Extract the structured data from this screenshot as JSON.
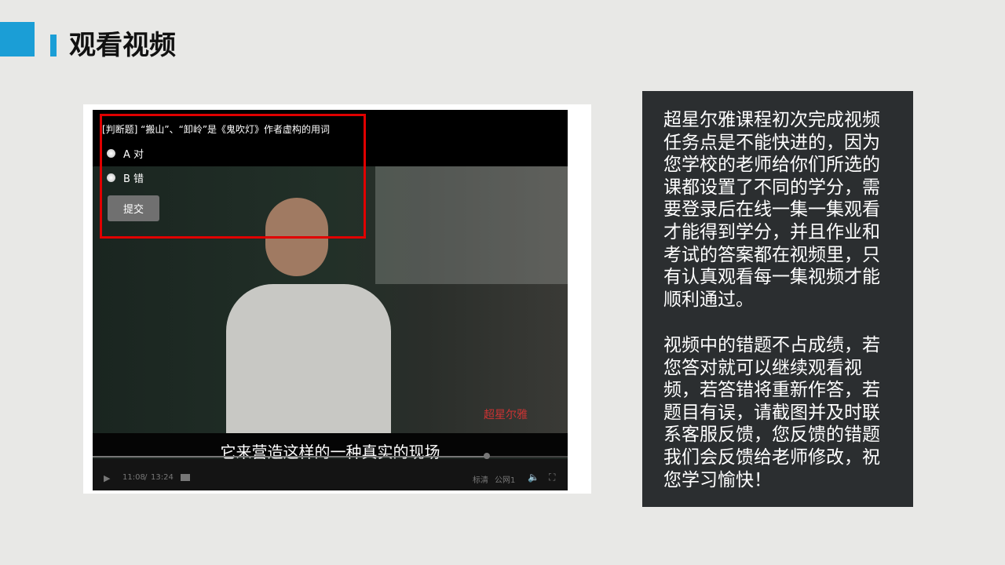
{
  "header": {
    "title": "观看视频"
  },
  "quiz": {
    "question": "[判断题] “搬山”、“卸岭”是《鬼吹灯》作者虚构的用词",
    "options": [
      "A 对",
      "B 错"
    ],
    "submit_label": "提交"
  },
  "player": {
    "subtitle": "它来营造这样的一种真实的现场",
    "current_time": "11:08",
    "separator": "/",
    "duration": "13:24",
    "progress": 0.83,
    "quality": "标清",
    "line": "公网1",
    "watermark": "超星尔雅"
  },
  "side": {
    "paragraph1": "超星尔雅课程初次完成视频任务点是不能快进的，因为您学校的老师给你们所选的课都设置了不同的学分，需要登录后在线一集一集观看才能得到学分，并且作业和考试的答案都在视频里，只有认真观看每一集视频才能顺利通过。",
    "paragraph2": "视频中的错题不占成绩，若您答对就可以继续观看视频，若答错将重新作答，若题目有误，请截图并及时联系客服反馈，您反馈的错题我们会反馈给老师修改，祝您学习愉快！"
  },
  "colors": {
    "accent": "#1b9ed6",
    "highlight": "#e00000",
    "panel": "#2b2e30"
  }
}
